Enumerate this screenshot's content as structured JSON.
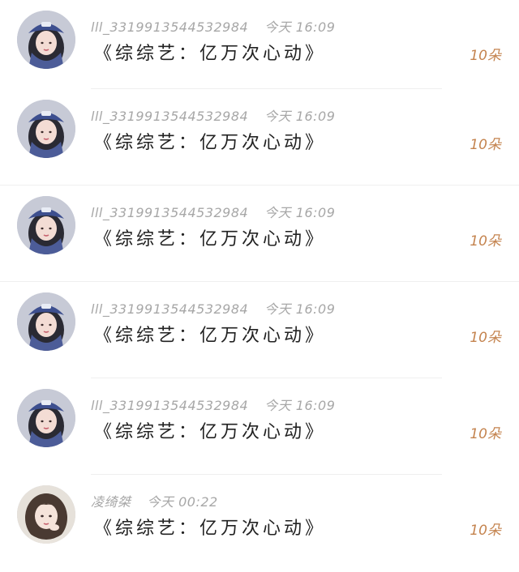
{
  "comments": [
    {
      "username": "lll_3319913544532984",
      "time": "今天 16:09",
      "gift": "《综综艺：亿万次心动》",
      "count": "10朵",
      "avatar_icon": "girl-blue-cap-avatar"
    },
    {
      "username": "lll_3319913544532984",
      "time": "今天 16:09",
      "gift": "《综综艺：亿万次心动》",
      "count": "10朵",
      "avatar_icon": "girl-blue-cap-avatar"
    },
    {
      "username": "lll_3319913544532984",
      "time": "今天 16:09",
      "gift": "《综综艺：亿万次心动》",
      "count": "10朵",
      "avatar_icon": "girl-blue-cap-avatar"
    },
    {
      "username": "lll_3319913544532984",
      "time": "今天 16:09",
      "gift": "《综综艺：亿万次心动》",
      "count": "10朵",
      "avatar_icon": "girl-blue-cap-avatar"
    },
    {
      "username": "lll_3319913544532984",
      "time": "今天 16:09",
      "gift": "《综综艺：亿万次心动》",
      "count": "10朵",
      "avatar_icon": "girl-blue-cap-avatar"
    },
    {
      "username": "凌绮桀",
      "time": "今天 00:22",
      "gift": "《综综艺：亿万次心动》",
      "count": "10朵",
      "avatar_icon": "girl-brown-hair-avatar"
    }
  ],
  "colors": {
    "count": "#c4834e",
    "meta": "#a7a7a7",
    "gift_text": "#222222",
    "cap_blue": "#3d4f8f"
  }
}
